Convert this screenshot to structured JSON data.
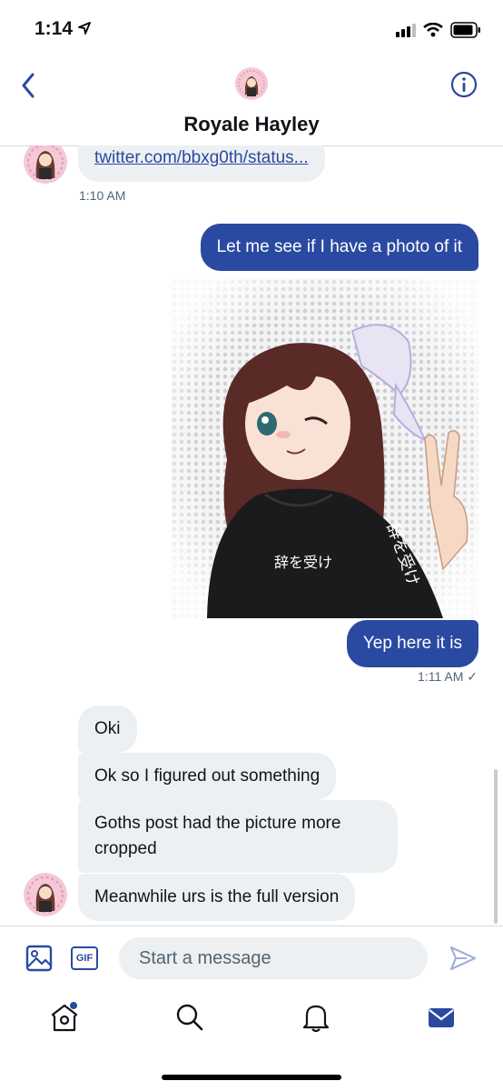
{
  "status_bar": {
    "time": "1:14"
  },
  "header": {
    "title": "Royale Hayley"
  },
  "conversation": {
    "link_message": "twitter.com/bbxg0th/status...",
    "link_time": "1:10 AM",
    "out_message_1": "Let me see if I have a photo of it",
    "photo_caption_center": "辞を受け",
    "photo_caption_right": "辞を受け",
    "out_message_2": "Yep here it is",
    "out_time": "1:11 AM ✓",
    "in_messages": [
      "Oki",
      "Ok so I figured out something",
      "Goths post had the picture more cropped",
      "Meanwhile urs is the full version"
    ]
  },
  "composer": {
    "placeholder": "Start a message",
    "gif_label": "GIF"
  },
  "colors": {
    "accent": "#2a4aa1",
    "bubble_in": "#edf0f2"
  }
}
